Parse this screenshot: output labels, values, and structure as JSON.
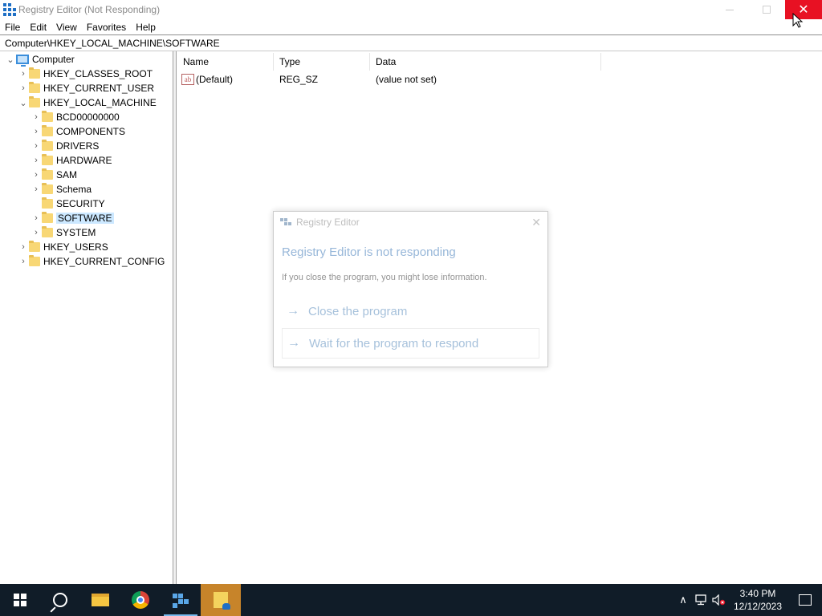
{
  "window": {
    "title": "Registry Editor (Not Responding)",
    "close_glyph": "✕"
  },
  "menu": [
    "File",
    "Edit",
    "View",
    "Favorites",
    "Help"
  ],
  "address": "Computer\\HKEY_LOCAL_MACHINE\\SOFTWARE",
  "tree": {
    "root": "Computer",
    "items": [
      {
        "label": "HKEY_CLASSES_ROOT",
        "level": 1,
        "expander": "›"
      },
      {
        "label": "HKEY_CURRENT_USER",
        "level": 1,
        "expander": "›"
      },
      {
        "label": "HKEY_LOCAL_MACHINE",
        "level": 1,
        "expander": "⌄"
      },
      {
        "label": "BCD00000000",
        "level": 2,
        "expander": "›"
      },
      {
        "label": "COMPONENTS",
        "level": 2,
        "expander": "›"
      },
      {
        "label": "DRIVERS",
        "level": 2,
        "expander": "›"
      },
      {
        "label": "HARDWARE",
        "level": 2,
        "expander": "›"
      },
      {
        "label": "SAM",
        "level": 2,
        "expander": "›"
      },
      {
        "label": "Schema",
        "level": 2,
        "expander": "›"
      },
      {
        "label": "SECURITY",
        "level": 2,
        "expander": ""
      },
      {
        "label": "SOFTWARE",
        "level": 2,
        "expander": "›",
        "selected": true
      },
      {
        "label": "SYSTEM",
        "level": 2,
        "expander": "›"
      },
      {
        "label": "HKEY_USERS",
        "level": 1,
        "expander": "›"
      },
      {
        "label": "HKEY_CURRENT_CONFIG",
        "level": 1,
        "expander": "›"
      }
    ]
  },
  "list": {
    "columns": [
      "Name",
      "Type",
      "Data"
    ],
    "rows": [
      {
        "icon": "string-value-icon",
        "icon_text": "ab",
        "name": "(Default)",
        "type": "REG_SZ",
        "data": "(value not set)"
      }
    ]
  },
  "dialog": {
    "title": "Registry Editor",
    "heading": "Registry Editor is not responding",
    "text": "If you close the program, you might lose information.",
    "option_close": "Close the program",
    "option_wait": "Wait for the program to respond",
    "arrow_glyph": "→",
    "close_glyph": "✕"
  },
  "taskbar": {
    "apps": [
      "start",
      "search",
      "file-explorer",
      "chrome",
      "registry-editor",
      "sticky-notes"
    ],
    "time": "3:40 PM",
    "date": "12/12/2023",
    "tray_chevron": "∧",
    "colors": {
      "taskbar": "#101c28",
      "active_app": "#c7842a"
    }
  }
}
